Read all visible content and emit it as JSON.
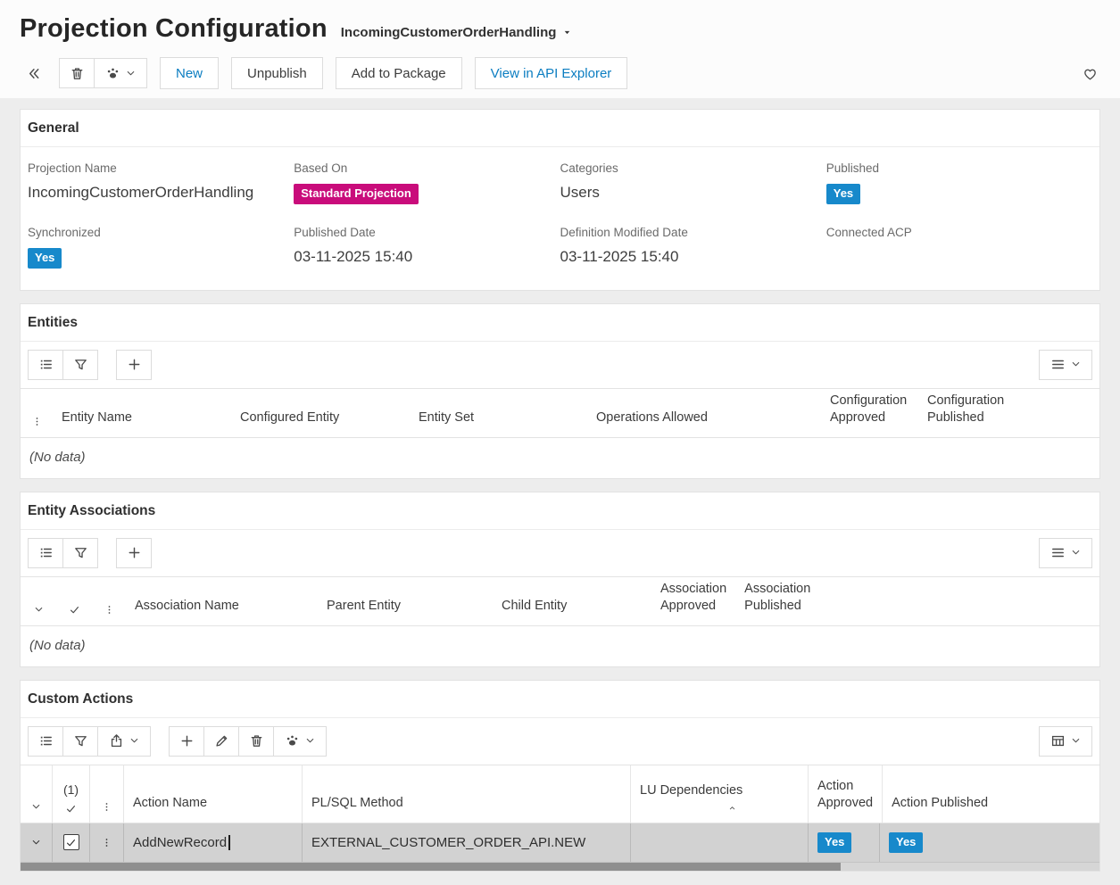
{
  "header": {
    "title": "Projection Configuration",
    "subtitle": "IncomingCustomerOrderHandling"
  },
  "toolbar": {
    "new": "New",
    "unpublish": "Unpublish",
    "add_to_package": "Add to Package",
    "view_in_api_explorer": "View in API Explorer"
  },
  "general": {
    "title": "General",
    "projection_name": {
      "label": "Projection Name",
      "value": "IncomingCustomerOrderHandling"
    },
    "based_on": {
      "label": "Based On",
      "value": "Standard Projection"
    },
    "categories": {
      "label": "Categories",
      "value": "Users"
    },
    "published": {
      "label": "Published",
      "value": "Yes"
    },
    "synchronized": {
      "label": "Synchronized",
      "value": "Yes"
    },
    "published_date": {
      "label": "Published Date",
      "value": "03-11-2025 15:40"
    },
    "definition_modified_date": {
      "label": "Definition Modified Date",
      "value": "03-11-2025 15:40"
    },
    "connected_acp": {
      "label": "Connected ACP",
      "value": ""
    }
  },
  "entities": {
    "title": "Entities",
    "columns": {
      "entity_name": "Entity Name",
      "configured_entity": "Configured Entity",
      "entity_set": "Entity Set",
      "operations_allowed": "Operations Allowed",
      "configuration_approved": "Configuration Approved",
      "configuration_published": "Configuration Published"
    },
    "no_data": "(No data)"
  },
  "entity_associations": {
    "title": "Entity Associations",
    "columns": {
      "association_name": "Association Name",
      "parent_entity": "Parent Entity",
      "child_entity": "Child Entity",
      "association_approved": "Association Approved",
      "association_published": "Association Published"
    },
    "no_data": "(No data)"
  },
  "custom_actions": {
    "title": "Custom Actions",
    "selection_count": "(1)",
    "columns": {
      "action_name": "Action Name",
      "plsql_method": "PL/SQL Method",
      "lu_dependencies": "LU Dependencies",
      "action_approved": "Action Approved",
      "action_published": "Action Published"
    },
    "rows": [
      {
        "action_name": "AddNewRecord",
        "plsql_method": "EXTERNAL_CUSTOMER_ORDER_API.NEW",
        "lu_dependencies": "",
        "action_approved": "Yes",
        "action_published": "Yes"
      }
    ]
  },
  "colors": {
    "accent_blue": "#0b7dc1",
    "badge_blue": "#1789cb",
    "badge_magenta": "#c90c7b",
    "selected_row": "#d2d2d2"
  }
}
